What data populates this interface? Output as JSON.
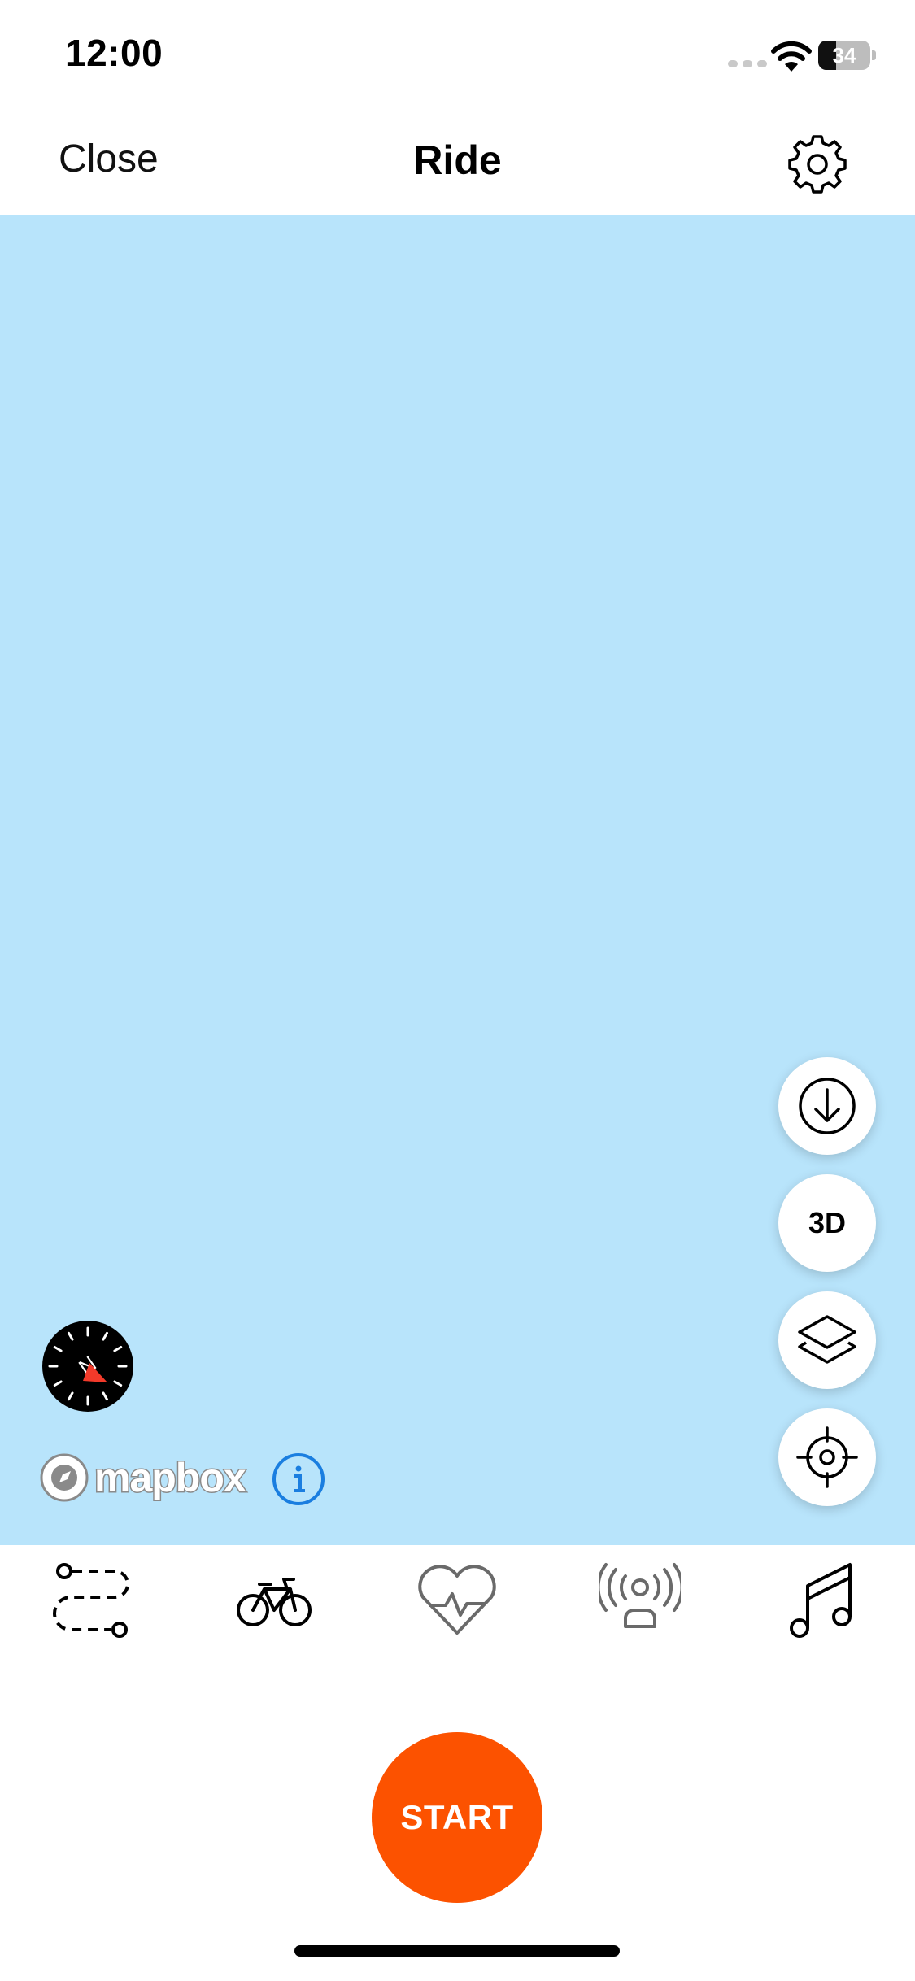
{
  "status_bar": {
    "time": "12:00",
    "battery": "34",
    "battery_level": 0.34
  },
  "nav": {
    "close_label": "Close",
    "title": "Ride",
    "settings_icon": "gear-icon"
  },
  "map": {
    "background_color": "#b8e4fb",
    "attribution": {
      "logo_text": "mapbox",
      "info_icon": "info-icon"
    },
    "controls": [
      {
        "name": "download-offline-map",
        "icon": "download-icon"
      },
      {
        "name": "toggle-3d",
        "label": "3D"
      },
      {
        "name": "map-layers",
        "icon": "layers-icon"
      },
      {
        "name": "recenter-location",
        "icon": "crosshair-icon"
      }
    ],
    "compass_icon": "compass-icon"
  },
  "tabs": [
    {
      "name": "route",
      "icon": "route-icon"
    },
    {
      "name": "sport-type",
      "icon": "bike-icon"
    },
    {
      "name": "heart-rate",
      "icon": "heart-rate-icon"
    },
    {
      "name": "beacon",
      "icon": "beacon-icon"
    },
    {
      "name": "music",
      "icon": "music-icon"
    }
  ],
  "start_button": {
    "label": "START",
    "color": "#fc5200"
  }
}
